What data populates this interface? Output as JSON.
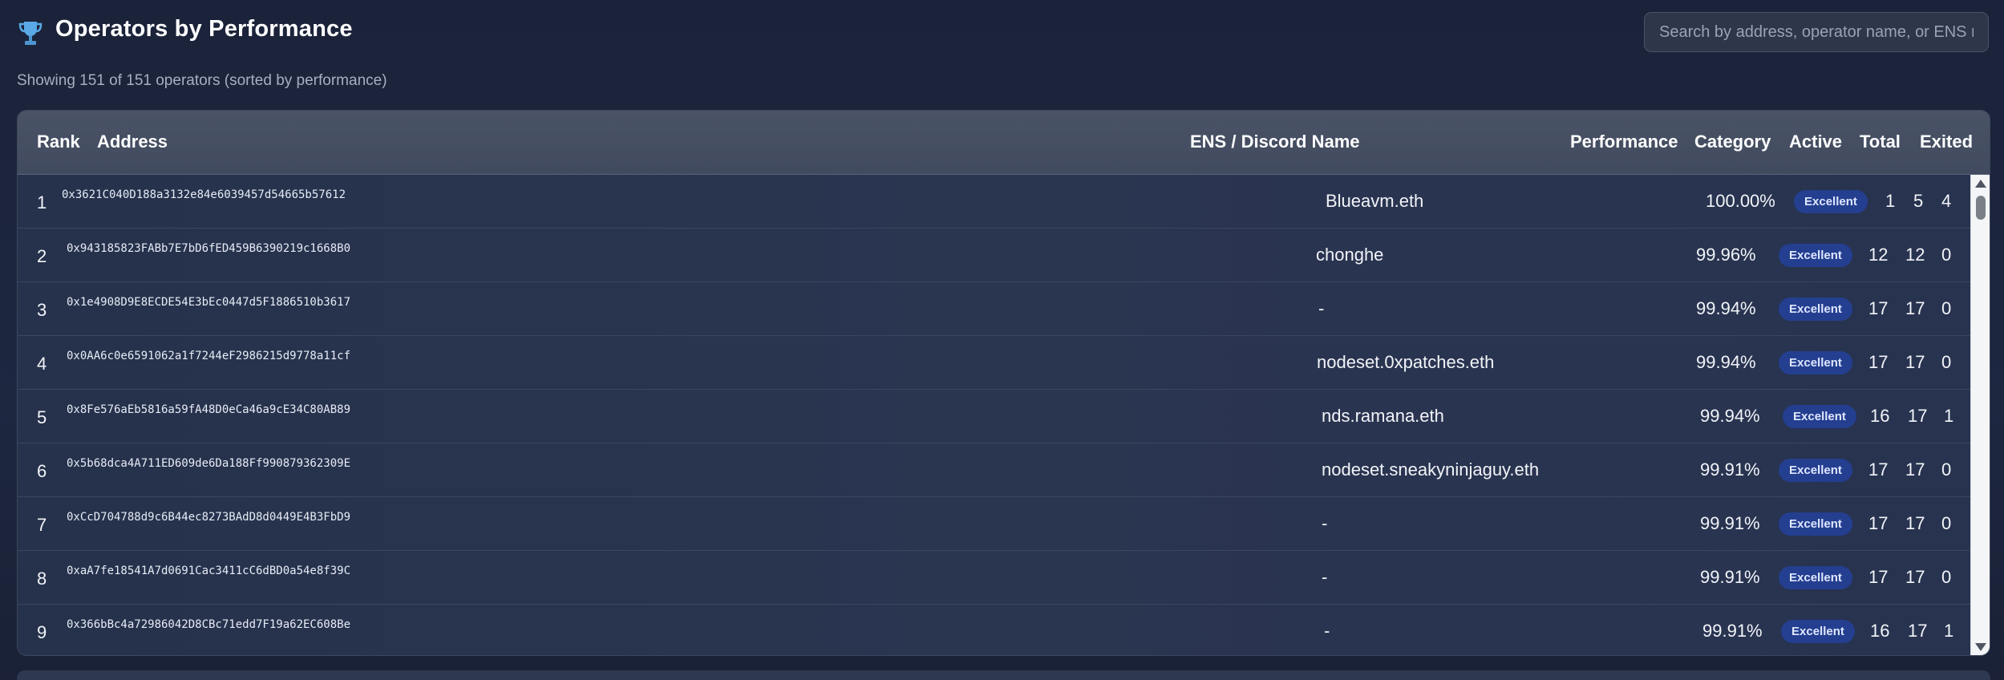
{
  "header": {
    "title": "Operators by Performance",
    "trophy_icon": "trophy-icon",
    "search_placeholder": "Search by address, operator name, or ENS name",
    "subtitle": "Showing 151 of 151 operators (sorted by performance)"
  },
  "table": {
    "columns": {
      "rank": "Rank",
      "address": "Address",
      "ens": "ENS / Discord Name",
      "performance": "Performance",
      "category": "Category",
      "active": "Active",
      "total": "Total",
      "exited": "Exited"
    },
    "rows": [
      {
        "rank": "1",
        "address": "0x3621C040D188a3132e84e6039457d54665b57612",
        "ens": "Blueavm.eth",
        "performance": "100.00%",
        "category": "Excellent",
        "active": "1",
        "total": "5",
        "exited": "4"
      },
      {
        "rank": "2",
        "address": "0x943185823FABb7E7bD6fED459B6390219c1668B0",
        "ens": "chonghe",
        "performance": "99.96%",
        "category": "Excellent",
        "active": "12",
        "total": "12",
        "exited": "0"
      },
      {
        "rank": "3",
        "address": "0x1e4908D9E8ECDE54E3bEc0447d5F1886510b3617",
        "ens": "-",
        "performance": "99.94%",
        "category": "Excellent",
        "active": "17",
        "total": "17",
        "exited": "0"
      },
      {
        "rank": "4",
        "address": "0x0AA6c0e6591062a1f7244eF2986215d9778a11cf",
        "ens": "nodeset.0xpatches.eth",
        "performance": "99.94%",
        "category": "Excellent",
        "active": "17",
        "total": "17",
        "exited": "0"
      },
      {
        "rank": "5",
        "address": "0x8Fe576aEb5816a59fA48D0eCa46a9cE34C80AB89",
        "ens": "nds.ramana.eth",
        "performance": "99.94%",
        "category": "Excellent",
        "active": "16",
        "total": "17",
        "exited": "1"
      },
      {
        "rank": "6",
        "address": "0x5b68dca4A711ED609de6Da188Ff990879362309E",
        "ens": "nodeset.sneakyninjaguy.eth",
        "performance": "99.91%",
        "category": "Excellent",
        "active": "17",
        "total": "17",
        "exited": "0"
      },
      {
        "rank": "7",
        "address": "0xCcD704788d9c6B44ec8273BAdD8d0449E4B3FbD9",
        "ens": "-",
        "performance": "99.91%",
        "category": "Excellent",
        "active": "17",
        "total": "17",
        "exited": "0"
      },
      {
        "rank": "8",
        "address": "0xaA7fe18541A7d0691Cac3411cC6dBD0a54e8f39C",
        "ens": "-",
        "performance": "99.91%",
        "category": "Excellent",
        "active": "17",
        "total": "17",
        "exited": "0"
      },
      {
        "rank": "9",
        "address": "0x366bBc4a72986042D8CBc71edd7F19a62EC608Be",
        "ens": "-",
        "performance": "99.91%",
        "category": "Excellent",
        "active": "16",
        "total": "17",
        "exited": "1"
      }
    ]
  },
  "colors": {
    "background": "#1b233a",
    "header_row": "#4a5366",
    "badge_bg": "#243f90",
    "badge_text": "#dfe6ff"
  }
}
